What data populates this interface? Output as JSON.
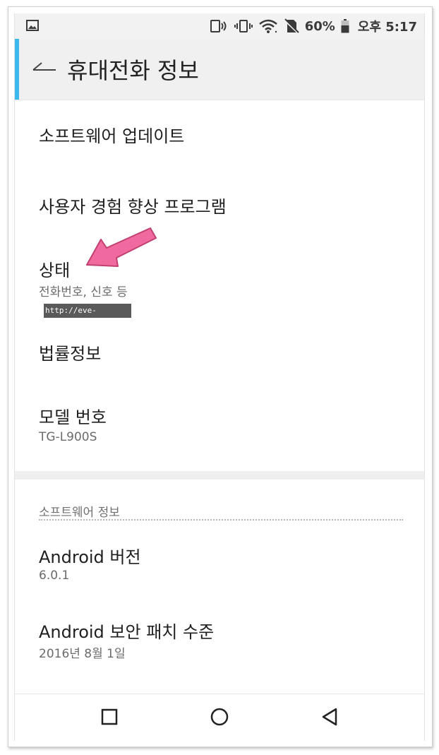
{
  "status_bar": {
    "battery_percent": "60%",
    "time": "오후 5:17",
    "icons": [
      "gallery-icon",
      "nfc-icon",
      "vibrate-icon",
      "wifi-icon",
      "no-sim-icon",
      "battery-icon"
    ]
  },
  "app_bar": {
    "title": "휴대전화 정보",
    "accent_color": "#3bb8ec"
  },
  "items": [
    {
      "title": "소프트웨어 업데이트"
    },
    {
      "title": "사용자 경험 향상 프로그램"
    },
    {
      "title": "상태",
      "subtitle": "전화번호, 신호 등"
    },
    {
      "title": "법률정보"
    },
    {
      "title": "모델 번호",
      "subtitle": "TG-L900S"
    }
  ],
  "software_section": {
    "header": "소프트웨어 정보",
    "items": [
      {
        "title": "Android 버전",
        "subtitle": "6.0.1"
      },
      {
        "title": "Android 보안 패치 수준",
        "subtitle": "2016년 8월 1일"
      }
    ]
  },
  "watermark": "http://eve-talk.com",
  "nav_bar": {
    "buttons": [
      "recents-icon",
      "home-icon",
      "back-icon"
    ]
  }
}
